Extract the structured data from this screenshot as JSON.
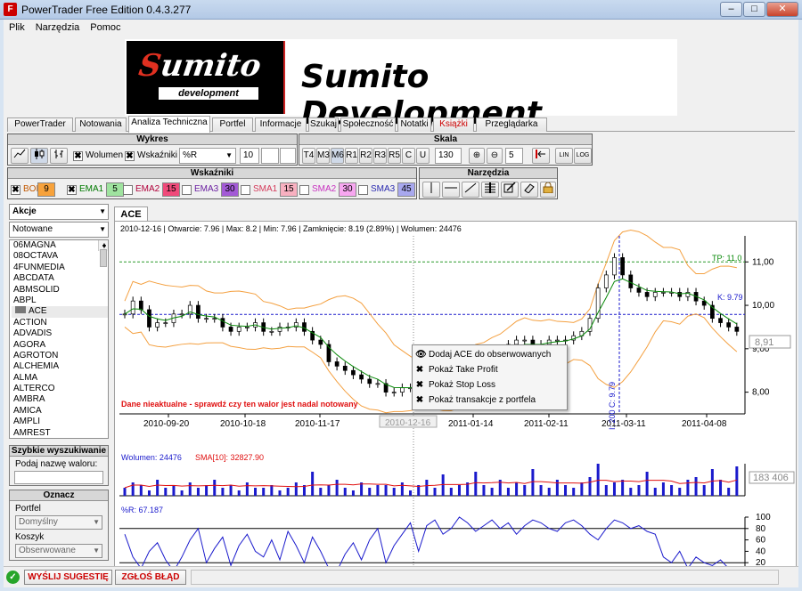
{
  "window": {
    "title": "PowerTrader Free Edition 0.4.3.277",
    "icon_letter": "F",
    "min": "–",
    "max": "□",
    "close": "✕"
  },
  "menu": [
    "Plik",
    "Narzędzia",
    "Pomoc"
  ],
  "banner": {
    "logo_word": "Sumito",
    "logo_sub": "development",
    "text": "Sumito Development"
  },
  "tabs": [
    {
      "label": "PowerTrader"
    },
    {
      "label": "Notowania"
    },
    {
      "label": "Analiza Techniczna",
      "active": true
    },
    {
      "label": "Portfel"
    },
    {
      "label": "Informacje"
    },
    {
      "label": "Szukaj"
    },
    {
      "label": "Społeczność"
    },
    {
      "label": "Notatki"
    },
    {
      "label": "Książki",
      "red": true
    },
    {
      "label": "Przeglądarka"
    }
  ],
  "wykres": {
    "title": "Wykres",
    "volume_label": "Wolumen",
    "indicators_label": "Wskaźniki",
    "indicator_value": "%R",
    "period": "10"
  },
  "skala": {
    "title": "Skala",
    "buttons": [
      "T4",
      "M3",
      "M6",
      "R1",
      "R2",
      "R3",
      "R5",
      "C",
      "U"
    ],
    "selected": "M6",
    "value1": "130",
    "value2": "5",
    "lin": "LIN",
    "log": "LOG"
  },
  "wskazniki": {
    "title": "Wskaźniki",
    "items": [
      {
        "name": "BOL",
        "checked": true,
        "value": "9",
        "color": "#f7a23b",
        "text_color": "#c25800"
      },
      {
        "name": "EMA1",
        "checked": true,
        "value": "5",
        "color": "#9fe39f",
        "text_color": "#007a00"
      },
      {
        "name": "EMA2",
        "checked": false,
        "value": "15",
        "color": "#f04a7a",
        "text_color": "#b0003a"
      },
      {
        "name": "EMA3",
        "checked": false,
        "value": "30",
        "color": "#a35ad6",
        "text_color": "#6a1fa0"
      },
      {
        "name": "SMA1",
        "checked": false,
        "value": "15",
        "color": "#f8b0c0",
        "text_color": "#d43a5a"
      },
      {
        "name": "SMA2",
        "checked": false,
        "value": "30",
        "color": "#f7a6f0",
        "text_color": "#c832c0"
      },
      {
        "name": "SMA3",
        "checked": false,
        "value": "45",
        "color": "#a8a8ee",
        "text_color": "#2a2ab0"
      }
    ]
  },
  "narzedzia": {
    "title": "Narzędzia"
  },
  "left": {
    "category": "Akcje",
    "filter": "Notowane",
    "stocks": [
      "06MAGNA",
      "08OCTAVA",
      "4FUNMEDIA",
      "ABCDATA",
      "ABMSOLID",
      "ABPL",
      "ACE",
      "ACTION",
      "ADVADIS",
      "AGORA",
      "AGROTON",
      "ALCHEMIA",
      "ALMA",
      "ALTERCO",
      "AMBRA",
      "AMICA",
      "AMPLI",
      "AMREST"
    ],
    "selected": "ACE",
    "quick_search_title": "Szybkie wyszukiwanie",
    "quick_search_label": "Podaj nazwę waloru:",
    "mark_title": "Oznacz",
    "portfel_label": "Portfel",
    "portfel_value": "Domyślny",
    "koszyk_label": "Koszyk",
    "koszyk_value": "Obserwowane"
  },
  "chart_tab": "ACE",
  "info_line": "2010-12-16 | Otwarcie: 7.96 | Max: 8.2 | Min: 7.96 | Zamknięcie: 8.19 (2.89%)  | Wolumen: 24476",
  "warning": "Dane nieaktualne - sprawdź czy ten walor jest nadal notowany",
  "tp_label": "TP: 11.0",
  "k_label": "K: 9.79",
  "price_tag": "8,91",
  "cursor_date": "2010-12-16",
  "vertical_label": "I: 200 C: 9.79",
  "x_dates": [
    "2010-09-20",
    "2010-10-18",
    "2010-11-17",
    "2011-01-14",
    "2011-02-11",
    "2011-03-11",
    "2011-04-08"
  ],
  "y_price_ticks": [
    "11,00",
    "10,00",
    "9,00",
    "8,00"
  ],
  "volume_info": {
    "label": "Wolumen: 24476",
    "sma": "SMA[10]: 32827.90",
    "tag": "183 406"
  },
  "r_info": {
    "label": "%R: 67.187",
    "ticks": [
      "100",
      "80",
      "60",
      "40",
      "20",
      "0"
    ]
  },
  "context_menu": [
    {
      "label": "Dodaj ACE do obserwowanych",
      "icon": "eye-icon"
    },
    {
      "label": "Pokaż Take Profit",
      "icon": "checkbox-icon"
    },
    {
      "label": "Pokaż Stop Loss",
      "icon": "checkbox-icon"
    },
    {
      "label": "Pokaż transakcje z portfela",
      "icon": "checkbox-icon"
    }
  ],
  "status": {
    "suggest": "WYŚLIJ SUGESTIĘ",
    "bug": "ZGŁOŚ BŁĄD"
  },
  "chart_data": {
    "type": "candlestick",
    "price_ylim": [
      7.5,
      11.6
    ],
    "close": [
      9.8,
      10.1,
      9.9,
      9.5,
      9.6,
      9.6,
      9.8,
      9.8,
      10.0,
      9.7,
      9.7,
      9.7,
      9.5,
      9.4,
      9.5,
      9.5,
      9.6,
      9.4,
      9.4,
      9.5,
      9.5,
      9.6,
      9.4,
      9.2,
      9.1,
      8.7,
      8.6,
      8.5,
      8.4,
      8.3,
      8.2,
      8.2,
      8.0,
      8.0,
      8.1,
      8.1,
      8.2,
      8.3,
      8.4,
      8.5,
      8.4,
      8.3,
      8.6,
      8.8,
      8.7,
      8.9,
      8.9,
      9.1,
      9.2,
      9.2,
      9.1,
      9.1,
      9.2,
      9.2,
      9.2,
      9.3,
      9.4,
      9.7,
      10.4,
      10.7,
      11.1,
      10.7,
      10.4,
      10.3,
      10.2,
      10.3,
      10.3,
      10.3,
      10.2,
      10.3,
      10.1,
      10.0,
      9.7,
      9.6,
      9.5,
      9.4
    ],
    "tp": 11.0,
    "k": 9.79,
    "volume_max": 183406,
    "r_ylim": [
      0,
      100
    ]
  }
}
